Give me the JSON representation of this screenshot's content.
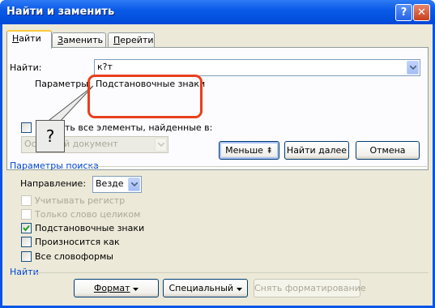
{
  "window": {
    "title": "Найти и заменить",
    "help_glyph": "?",
    "close_glyph": "✕"
  },
  "tabs": [
    {
      "label": "Найти",
      "underline": "Н",
      "rest": "айти",
      "active": true
    },
    {
      "label": "Заменить",
      "underline": "З",
      "rest": "аменить"
    },
    {
      "label": "Перейти",
      "underline": "П",
      "rest": "ерейти"
    }
  ],
  "find": {
    "label_prefix": "Найти",
    "label_suffix": ":",
    "value": "к?т",
    "options_label": "Параметры:",
    "options_value": "Подстановочные знаки"
  },
  "highlight_in": {
    "label_partial": "ть все элементы, найденные в:",
    "select_value": "Основной документ"
  },
  "buttons": {
    "less": "Меньше",
    "less_glyph": "⇞",
    "find_next": "Найти далее",
    "cancel": "Отмена",
    "format": "Формат",
    "special": "Специальный",
    "no_formatting": "Снять форматирование"
  },
  "search_options": {
    "title": "Параметры поиска",
    "direction_label": "Направление:",
    "direction_value": "Везде",
    "options": [
      {
        "label": "Учитывать регистр",
        "checked": false,
        "disabled": true
      },
      {
        "label": "Только слово целиком",
        "checked": false,
        "disabled": true
      },
      {
        "label": "Подстановочные знаки",
        "checked": true,
        "disabled": false
      },
      {
        "label": "Произносится как",
        "checked": false,
        "disabled": false
      },
      {
        "label": "Все словоформы",
        "checked": false,
        "disabled": false
      }
    ]
  },
  "find_group_title": "Найти",
  "callout": {
    "text": "?"
  },
  "colors": {
    "accent_group": "#0046d5",
    "highlight": "#e8401c",
    "title_bar": "#0a5be8"
  }
}
